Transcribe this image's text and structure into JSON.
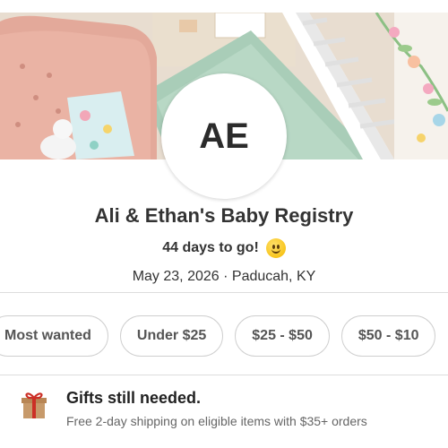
{
  "registry": {
    "initials": "AE",
    "title": "Ali & Ethan's Baby Registry",
    "countdown": "44 days to go!",
    "date": "May 23, 2026",
    "separator": "·",
    "location": "Paducah, KY"
  },
  "filters": [
    {
      "label": "Most wanted"
    },
    {
      "label": "Under $25"
    },
    {
      "label": "$25 - $50"
    },
    {
      "label": "$50 - $10"
    }
  ],
  "gifts_banner": {
    "heading": "Gifts still needed.",
    "subtext": "Free 2-day shipping on eligible items with $35+ orders",
    "icon": "gift-icon"
  },
  "colors": {
    "gift_red": "#cc2f26",
    "gift_box": "#c79a6b",
    "emoji": "#f8c51c"
  }
}
